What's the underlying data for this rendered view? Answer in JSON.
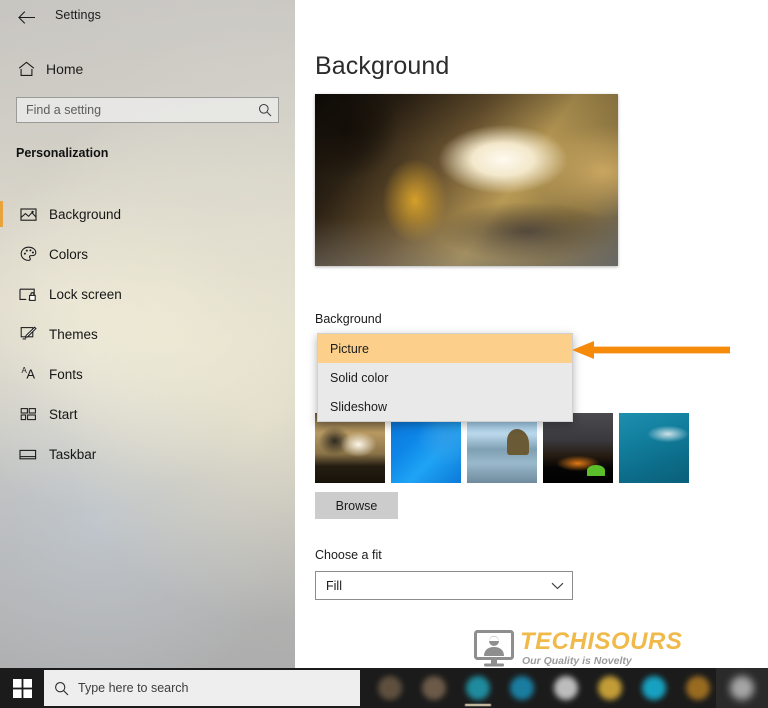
{
  "window": {
    "back_icon": "back-arrow-icon",
    "title": "Settings"
  },
  "sidebar": {
    "home": {
      "label": "Home",
      "icon": "home-icon"
    },
    "search": {
      "placeholder": "Find a setting",
      "value": "",
      "icon": "search-icon"
    },
    "section_header": "Personalization",
    "accent_color": "#e8a33d",
    "items": [
      {
        "label": "Background",
        "icon": "picture-icon",
        "selected": true
      },
      {
        "label": "Colors",
        "icon": "palette-icon",
        "selected": false
      },
      {
        "label": "Lock screen",
        "icon": "lock-screen-icon",
        "selected": false
      },
      {
        "label": "Themes",
        "icon": "themes-icon",
        "selected": false
      },
      {
        "label": "Fonts",
        "icon": "fonts-icon",
        "selected": false
      },
      {
        "label": "Start",
        "icon": "start-icon",
        "selected": false
      },
      {
        "label": "Taskbar",
        "icon": "taskbar-icon",
        "selected": false
      }
    ]
  },
  "main": {
    "page_title": "Background",
    "preview_alt": "wallpaper-preview",
    "background_label": "Background",
    "background_dropdown": {
      "selected": "Picture",
      "open": true,
      "highlight_color": "#fcd08b",
      "options": [
        "Picture",
        "Solid color",
        "Slideshow"
      ]
    },
    "choose_picture_thumbnails": [
      "thumbnail-1",
      "thumbnail-2",
      "thumbnail-3",
      "thumbnail-4",
      "thumbnail-5"
    ],
    "browse_label": "Browse",
    "fit_label": "Choose a fit",
    "fit_value": "Fill",
    "chevron_icon": "chevron-down-icon"
  },
  "annotation": {
    "arrow_icon": "left-arrow-annotation",
    "color": "#f58a0b"
  },
  "watermark": {
    "name": "TECHISOURS",
    "tagline": "Our Quality is Novelty",
    "name_color": "#f0b94a",
    "tagline_color": "#9b9b9b",
    "icon": "monitor-person-logo-icon"
  },
  "taskbar": {
    "start_icon": "windows-start-icon",
    "search": {
      "placeholder": "Type here to search",
      "value": "",
      "icon": "search-icon"
    },
    "pinned_icons": [
      {
        "name": "taskbar-icon-1",
        "color": "#6b5a45",
        "active": false
      },
      {
        "name": "taskbar-icon-2",
        "color": "#7a6550",
        "active": false
      },
      {
        "name": "taskbar-icon-3",
        "color": "#1f9fb5",
        "active": true
      },
      {
        "name": "taskbar-icon-4",
        "color": "#1a8fb8",
        "active": false
      },
      {
        "name": "taskbar-icon-5",
        "color": "#d9d9d9",
        "active": false
      },
      {
        "name": "taskbar-icon-6",
        "color": "#e0b43c",
        "active": false
      },
      {
        "name": "taskbar-icon-7",
        "color": "#17b9de",
        "active": false
      },
      {
        "name": "taskbar-icon-8",
        "color": "#b07a22",
        "active": false
      }
    ]
  }
}
